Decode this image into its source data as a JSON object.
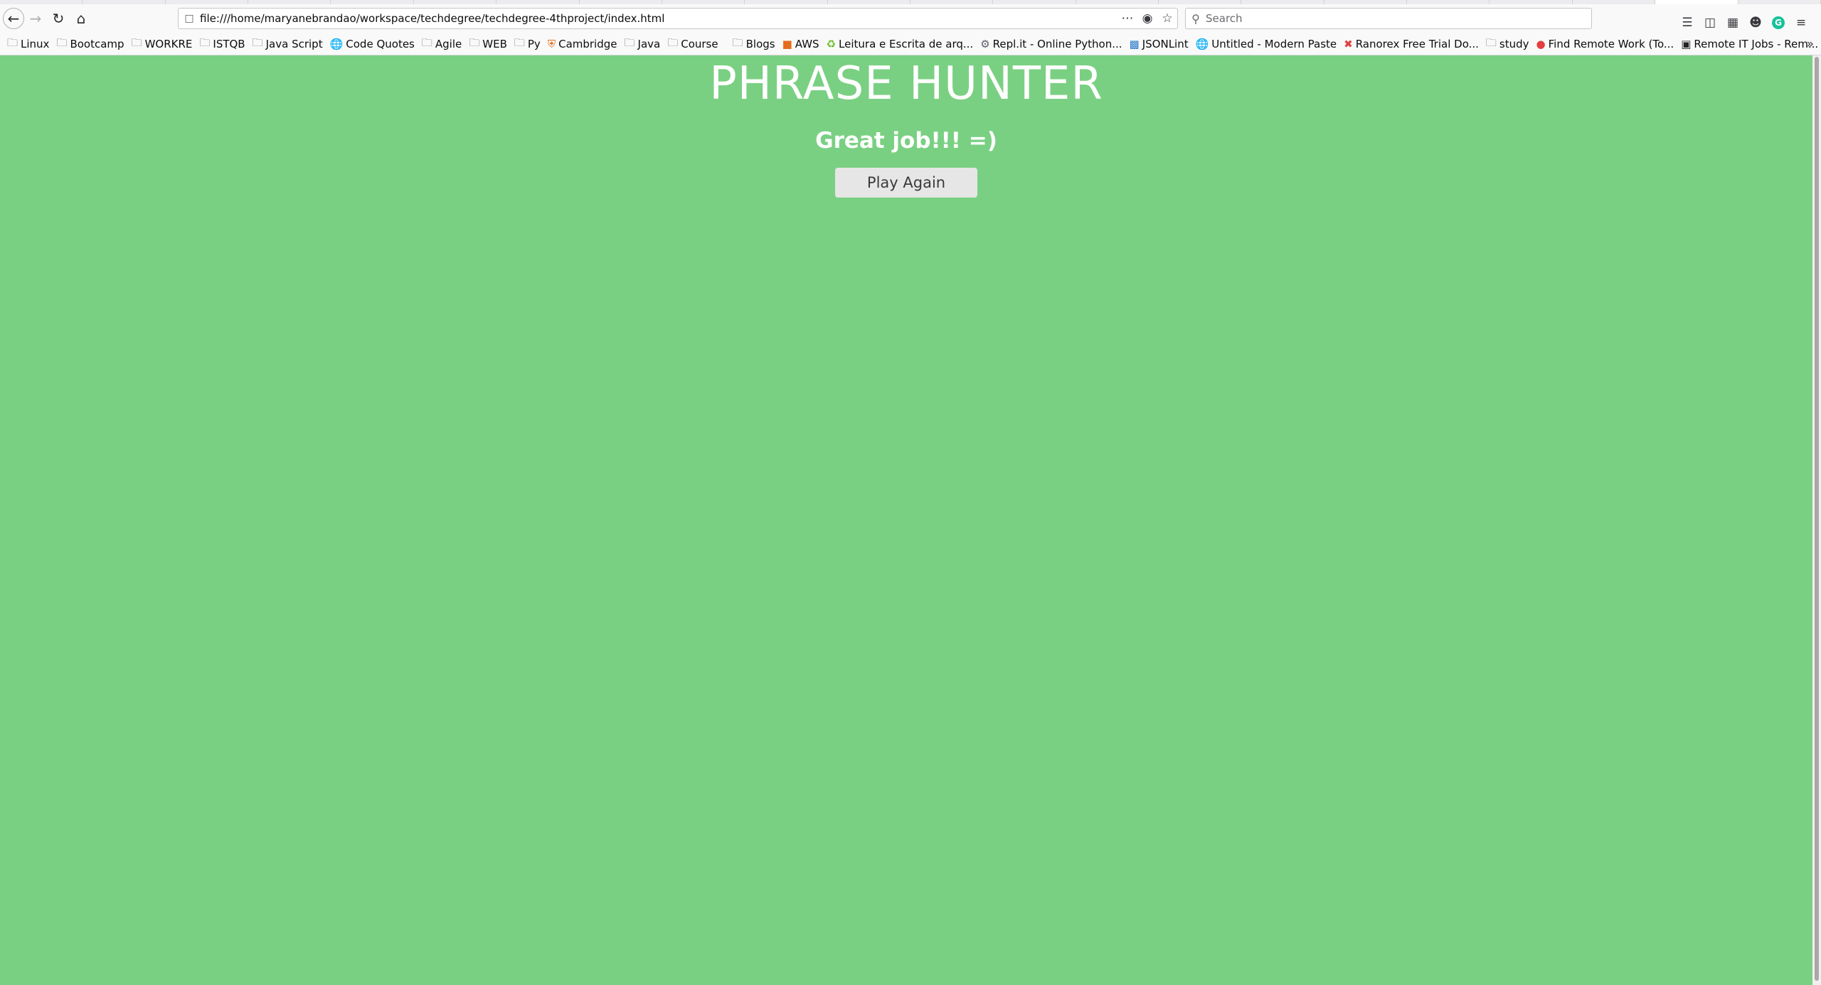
{
  "browser": {
    "url": "file:///home/maryanebrandao/workspace/techdegree/techdegree-4thproject/index.html",
    "search_placeholder": "Search",
    "bookmarks": [
      {
        "label": "Linux",
        "icon": "folder-icon"
      },
      {
        "label": "Bootcamp",
        "icon": "folder-icon"
      },
      {
        "label": "WORKRE",
        "icon": "folder-icon"
      },
      {
        "label": "ISTQB",
        "icon": "folder-icon"
      },
      {
        "label": "Java Script",
        "icon": "folder-icon"
      },
      {
        "label": "Code Quotes",
        "icon": "globe-icon"
      },
      {
        "label": "Agile",
        "icon": "folder-icon"
      },
      {
        "label": "WEB",
        "icon": "folder-icon"
      },
      {
        "label": "Py",
        "icon": "folder-icon"
      },
      {
        "label": "Cambridge",
        "icon": "shield-icon"
      },
      {
        "label": "Java",
        "icon": "folder-icon"
      },
      {
        "label": "Course",
        "icon": "folder-icon"
      },
      {
        "label": "Blogs",
        "icon": "folder-icon"
      },
      {
        "label": "AWS",
        "icon": "cube-icon"
      },
      {
        "label": "Leitura e Escrita de arq...",
        "icon": "recycle-icon"
      },
      {
        "label": "Repl.it - Online Python...",
        "icon": "gear-icon"
      },
      {
        "label": "JSONLint",
        "icon": "square-icon"
      },
      {
        "label": "Untitled - Modern Paste",
        "icon": "globe-icon"
      },
      {
        "label": "Ranorex Free Trial Do...",
        "icon": "ranorex-icon"
      },
      {
        "label": "study",
        "icon": "folder-icon"
      },
      {
        "label": "Find Remote Work (To...",
        "icon": "circle-icon"
      },
      {
        "label": "Remote IT Jobs - Rem...",
        "icon": "r-icon"
      }
    ]
  },
  "page": {
    "background_color": "#7ad082",
    "title": "PHRASE HUNTER",
    "message": "Great job!!! =)",
    "play_again_label": "Play Again"
  }
}
